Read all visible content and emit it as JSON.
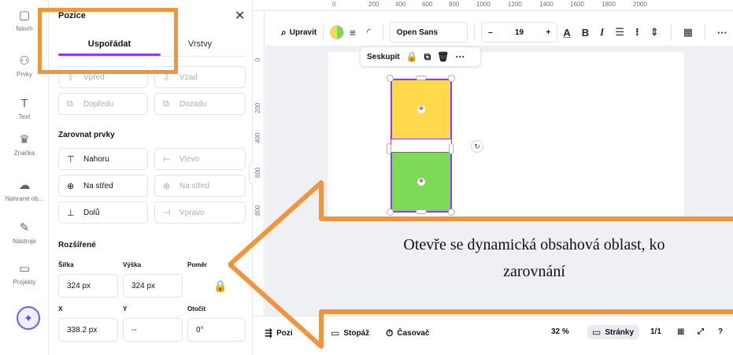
{
  "rail": {
    "items": [
      {
        "label": "Návrh",
        "icon": "design-icon"
      },
      {
        "label": "Prvky",
        "icon": "elements-icon"
      },
      {
        "label": "Text",
        "icon": "text-icon"
      },
      {
        "label": "Značka",
        "icon": "brand-icon"
      },
      {
        "label": "Nahrané ob...",
        "icon": "uploads-icon"
      },
      {
        "label": "Nástroje",
        "icon": "tools-icon"
      },
      {
        "label": "Projekty",
        "icon": "projects-icon"
      }
    ],
    "magic_icon": "magic-sparkle-icon"
  },
  "panel": {
    "title": "Pozice",
    "tabs": {
      "arrange": "Uspořádat",
      "layers": "Vrstvy"
    },
    "order": {
      "forward_top": "Vpřed",
      "back_top": "Vzad",
      "forward": "Dopředu",
      "backward": "Dozadu"
    },
    "align_title": "Zarovnat prvky",
    "align": {
      "top": "Nahoru",
      "left": "Vlevo",
      "middle": "Na střed",
      "center": "Na střed",
      "bottom": "Dolů",
      "right": "Vpravo"
    },
    "advanced_title": "Rozšířené",
    "width_label": "Šířka",
    "height_label": "Výška",
    "ratio_label": "Poměr",
    "width_value": "324 px",
    "height_value": "324 px",
    "x_label": "X",
    "y_label": "Y",
    "rotate_label": "Otočit",
    "x_value": "338.2 px",
    "y_value": "--",
    "rotate_value": "0°"
  },
  "ruler": {
    "top_ticks": [
      "0",
      "200",
      "400",
      "600",
      "800",
      "1000",
      "1200",
      "1400",
      "1600",
      "1800",
      "2000"
    ],
    "left_ticks": [
      "0",
      "200",
      "400",
      "600",
      "800"
    ]
  },
  "toolbar": {
    "edit_label": "Upravit",
    "font": "Open Sans",
    "font_size": "19",
    "minus": "–",
    "plus": "+",
    "text_color_glyph": "A",
    "bold": "B",
    "italic": "I",
    "more": "···"
  },
  "context_bar": {
    "group_label": "Seskupit",
    "more": "···"
  },
  "annotation": {
    "caption_line1": "Otevře se dynamická obsahová oblast, ko",
    "caption_line2": "zarovnání",
    "color": "#f0953c"
  },
  "bottom": {
    "position_label": "Pozi",
    "notes": "Stopáž",
    "timer": "Časovač",
    "zoom": "32 %",
    "pages": "Stránky",
    "page_count": "1/1"
  },
  "colors": {
    "accent": "#8b3dff",
    "yellow": "#ffd84b",
    "green": "#7ed957",
    "callout": "#f0953c"
  }
}
